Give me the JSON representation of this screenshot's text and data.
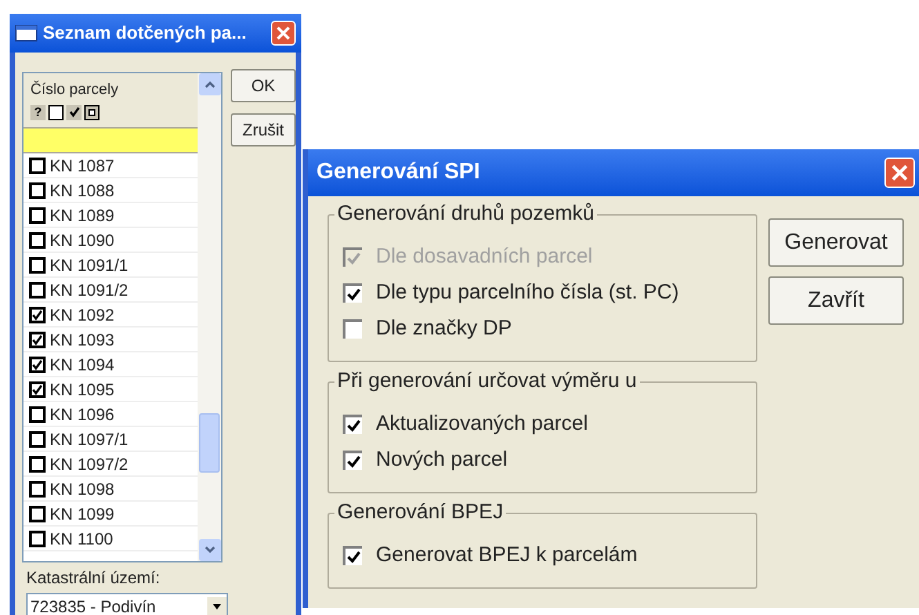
{
  "list_window": {
    "title": "Seznam dotčených pa...",
    "column_header": "Číslo parcely",
    "filter_help": "?",
    "parcels": [
      {
        "label": "KN 1087",
        "checked": false
      },
      {
        "label": "KN 1088",
        "checked": false
      },
      {
        "label": "KN 1089",
        "checked": false
      },
      {
        "label": "KN 1090",
        "checked": false
      },
      {
        "label": "KN 1091/1",
        "checked": false
      },
      {
        "label": "KN 1091/2",
        "checked": false
      },
      {
        "label": "KN 1092",
        "checked": true
      },
      {
        "label": "KN 1093",
        "checked": true
      },
      {
        "label": "KN 1094",
        "checked": true
      },
      {
        "label": "KN 1095",
        "checked": true
      },
      {
        "label": "KN 1096",
        "checked": false
      },
      {
        "label": "KN 1097/1",
        "checked": false
      },
      {
        "label": "KN 1097/2",
        "checked": false
      },
      {
        "label": "KN 1098",
        "checked": false
      },
      {
        "label": "KN 1099",
        "checked": false
      },
      {
        "label": "KN 1100",
        "checked": false
      }
    ],
    "buttons": [
      "OK",
      "Zrušit"
    ],
    "territory_label": "Katastrální území:",
    "territory_value": "723835 - Podivín"
  },
  "spi_window": {
    "title": "Generování SPI",
    "groups": [
      {
        "title": "Generování druhů pozemků",
        "options": [
          {
            "label": "Dle dosavadních parcel",
            "checked": true,
            "disabled": true
          },
          {
            "label": "Dle typu parcelního čísla (st. PC)",
            "checked": true,
            "disabled": false
          },
          {
            "label": "Dle značky DP",
            "checked": false,
            "disabled": false
          }
        ]
      },
      {
        "title": "Při generování určovat výměru u",
        "options": [
          {
            "label": "Aktualizovaných parcel",
            "checked": true,
            "disabled": false
          },
          {
            "label": "Nových parcel",
            "checked": true,
            "disabled": false
          }
        ]
      },
      {
        "title": "Generování BPEJ",
        "options": [
          {
            "label": "Generovat BPEJ k parcelám",
            "checked": true,
            "disabled": false
          }
        ]
      }
    ],
    "buttons": [
      "Generovat",
      "Zavřít"
    ]
  }
}
